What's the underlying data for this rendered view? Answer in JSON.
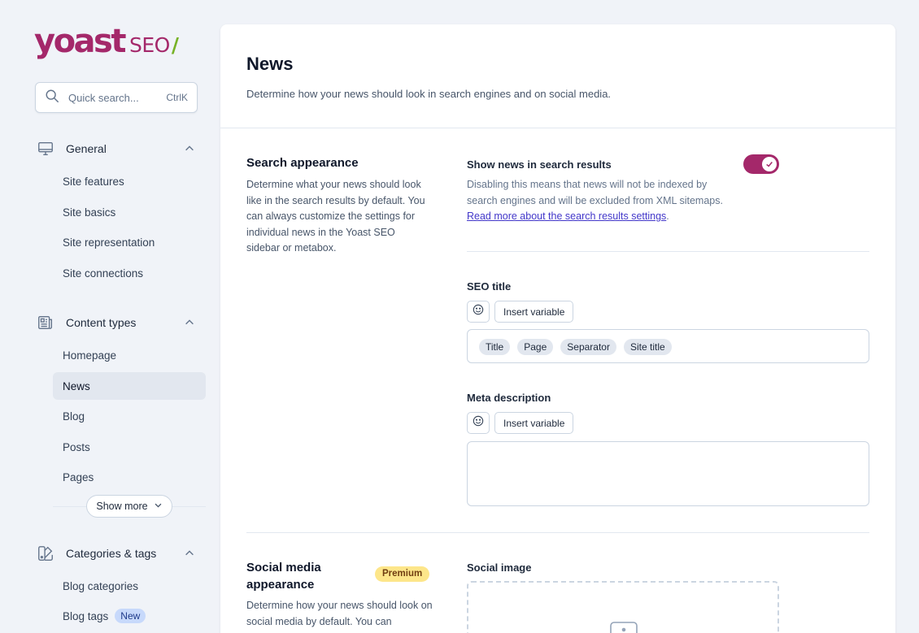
{
  "brand": {
    "word": "yoast",
    "product": "SEO",
    "slash": "/",
    "primary_color": "#a4286a",
    "accent_color": "#77b227"
  },
  "search": {
    "placeholder": "Quick search...",
    "shortcut": "CtrlK",
    "icon": "search-icon"
  },
  "sidebar": {
    "groups": [
      {
        "label": "General",
        "icon": "desktop-icon",
        "expanded": true,
        "items": [
          {
            "label": "Site features"
          },
          {
            "label": "Site basics"
          },
          {
            "label": "Site representation"
          },
          {
            "label": "Site connections"
          }
        ]
      },
      {
        "label": "Content types",
        "icon": "newspaper-icon",
        "expanded": true,
        "items": [
          {
            "label": "Homepage"
          },
          {
            "label": "News",
            "active": true
          },
          {
            "label": "Blog"
          },
          {
            "label": "Posts"
          },
          {
            "label": "Pages"
          }
        ],
        "show_more": "Show more"
      },
      {
        "label": "Categories & tags",
        "icon": "color-swatch-icon",
        "expanded": true,
        "items": [
          {
            "label": "Blog categories"
          },
          {
            "label": "Blog tags",
            "badge": "New"
          }
        ]
      }
    ]
  },
  "main": {
    "title": "News",
    "description": "Determine how your news should look in search engines and on social media.",
    "search_appearance": {
      "title": "Search appearance",
      "description": "Determine what your news should look like in the search results by default. You can always customize the settings for individual news in the Yoast SEO sidebar or metabox.",
      "show_in_results": {
        "label": "Show news in search results",
        "description": "Disabling this means that news will not be indexed by search engines and will be excluded from XML sitemaps.",
        "link_text": "Read more about the search results settings",
        "suffix": ".",
        "enabled": true
      },
      "seo_title": {
        "label": "SEO title",
        "insert_variable": "Insert variable",
        "chips": [
          "Title",
          "Page",
          "Separator",
          "Site title"
        ]
      },
      "meta_description": {
        "label": "Meta description",
        "insert_variable": "Insert variable",
        "value": ""
      }
    },
    "social_appearance": {
      "title": "Social media appearance",
      "badge": "Premium",
      "description": "Determine how your news should look on social media by default. You can",
      "social_image": {
        "label": "Social image"
      }
    }
  }
}
